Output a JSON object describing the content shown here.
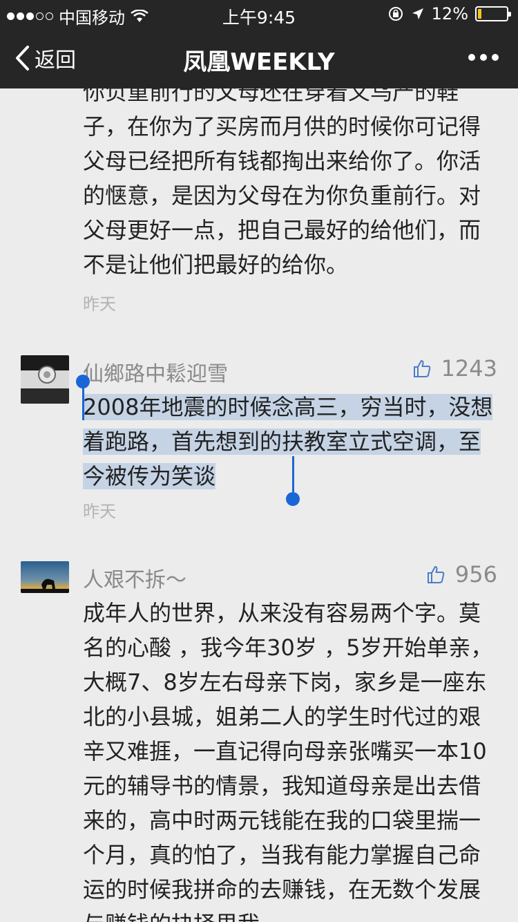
{
  "status_bar": {
    "carrier": "中国移动",
    "time": "上午9:45",
    "battery": "12%",
    "battery_level": 0.12
  },
  "nav": {
    "back_label": "返回",
    "title": "凤凰WEEKLY"
  },
  "comments": [
    {
      "text": "你负重前行的父母还在穿着义乌产的鞋子，在你为了买房而月供的时候你可记得父母已经把所有钱都掏出来给你了。你活的惬意，是因为父母在为你负重前行。对父母更好一点，把自己最好的给他们，而不是让他们把最好的给你。",
      "date": "昨天"
    },
    {
      "name": "仙鄉路中鬆迎雪",
      "likes": "1243",
      "text": "2008年地震的时候念高三，穷当时，没想着跑路，首先想到的扶教室立式空调，至今被传为笑谈",
      "date": "昨天",
      "selected": true
    },
    {
      "name": "人艰不拆～",
      "likes": "956",
      "text": "成年人的世界，从来没有容易两个字。莫名的心酸 ，我今年30岁 ，5岁开始单亲，大概7、8岁左右母亲下岗，家乡是一座东北的小县城，姐弟二人的学生时代过的艰辛又难捱，一直记得向母亲张嘴买一本10元的辅导书的情景，我知道母亲是出去借来的，高中时两元钱能在我的口袋里揣一个月，真的怕了，当我有能力掌握自己命运的时候我拼命的去赚钱，在无数个发展与赚钱的抉择里我"
    }
  ],
  "colors": {
    "nav_bg": "#262626",
    "page_bg": "#ececec",
    "selection": "#c5d3e5",
    "caret": "#1a66d6"
  }
}
